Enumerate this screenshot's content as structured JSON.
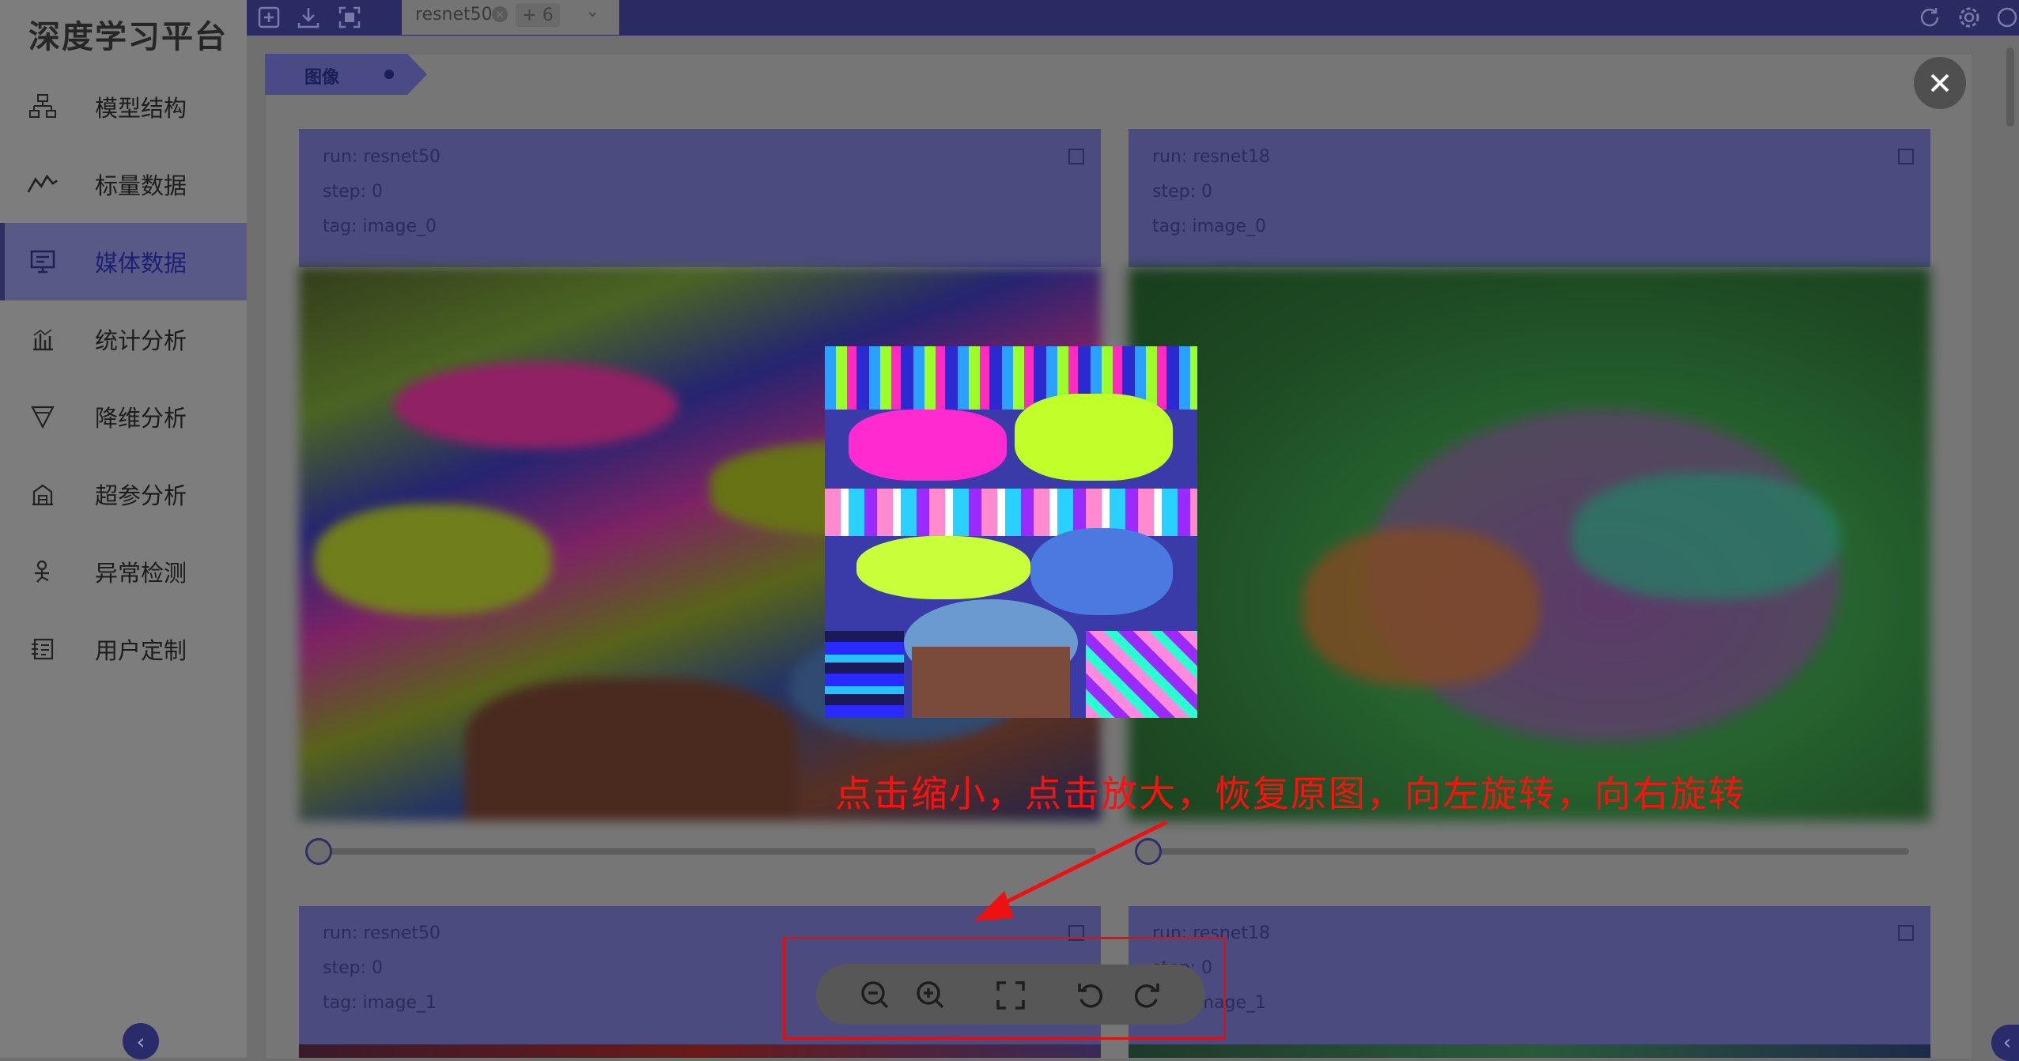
{
  "app": {
    "title": "深度学习平台"
  },
  "sidebar": {
    "items": [
      {
        "label": "模型结构",
        "icon": "model-structure-icon"
      },
      {
        "label": "标量数据",
        "icon": "line-chart-icon"
      },
      {
        "label": "媒体数据",
        "icon": "monitor-icon",
        "active": true
      },
      {
        "label": "统计分析",
        "icon": "bar-chart-icon"
      },
      {
        "label": "降维分析",
        "icon": "funnel-icon"
      },
      {
        "label": "超参分析",
        "icon": "building-icon"
      },
      {
        "label": "异常检测",
        "icon": "person-pin-icon"
      },
      {
        "label": "用户定制",
        "icon": "custom-icon"
      }
    ],
    "collapse_glyph": "‹"
  },
  "topbar": {
    "tab_label": "resnet50",
    "tab_extra_count": "+ 6",
    "icons": [
      "import-icon",
      "download-icon",
      "fullscreen-icon",
      "refresh-icon",
      "settings-icon",
      "language-icon"
    ]
  },
  "section": {
    "label": "图像"
  },
  "cards": [
    {
      "run": "run: resnet50",
      "step": "step: 0",
      "tag": "tag: image_0"
    },
    {
      "run": "run: resnet18",
      "step": "step: 0",
      "tag": "tag: image_0"
    },
    {
      "run": "run: resnet50",
      "step": "step: 0",
      "tag": "tag: image_1"
    },
    {
      "run": "run: resnet18",
      "step": "step: 0",
      "tag": "tag: image_1"
    }
  ],
  "viewer": {
    "close_glyph": "✕",
    "tools": [
      "zoom-out-icon",
      "zoom-in-icon",
      "reset-icon",
      "rotate-left-icon",
      "rotate-right-icon"
    ]
  },
  "annotation": {
    "text": "点击缩小，点击放大，恢复原图，向左旋转，向右旋转",
    "color": "#ff1010"
  },
  "colors": {
    "accent": "#2a2b63",
    "card_header": "#4b4b80",
    "highlight": "#dd1111"
  }
}
